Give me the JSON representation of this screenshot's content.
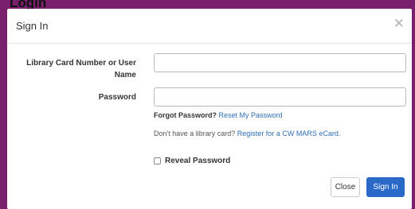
{
  "background": {
    "heading_fragment": "Login",
    "color": "#7a1f6e"
  },
  "modal": {
    "title": "Sign In",
    "close_icon": "close-icon",
    "fields": {
      "card_label_line1": "Library Card Number or User",
      "card_label_line2": "Name",
      "card_value": "",
      "password_label": "Password",
      "password_value": ""
    },
    "forgot": {
      "prefix": "Forgot Password?",
      "link": "Reset My Password"
    },
    "register": {
      "prefix": "Don't have a library card?",
      "link": "Register for a CW MARS eCard."
    },
    "reveal_password_label": "Reveal Password",
    "buttons": {
      "close": "Close",
      "sign_in": "Sign In"
    },
    "accent_color": "#2a69c7",
    "link_color": "#2a6eb8"
  }
}
